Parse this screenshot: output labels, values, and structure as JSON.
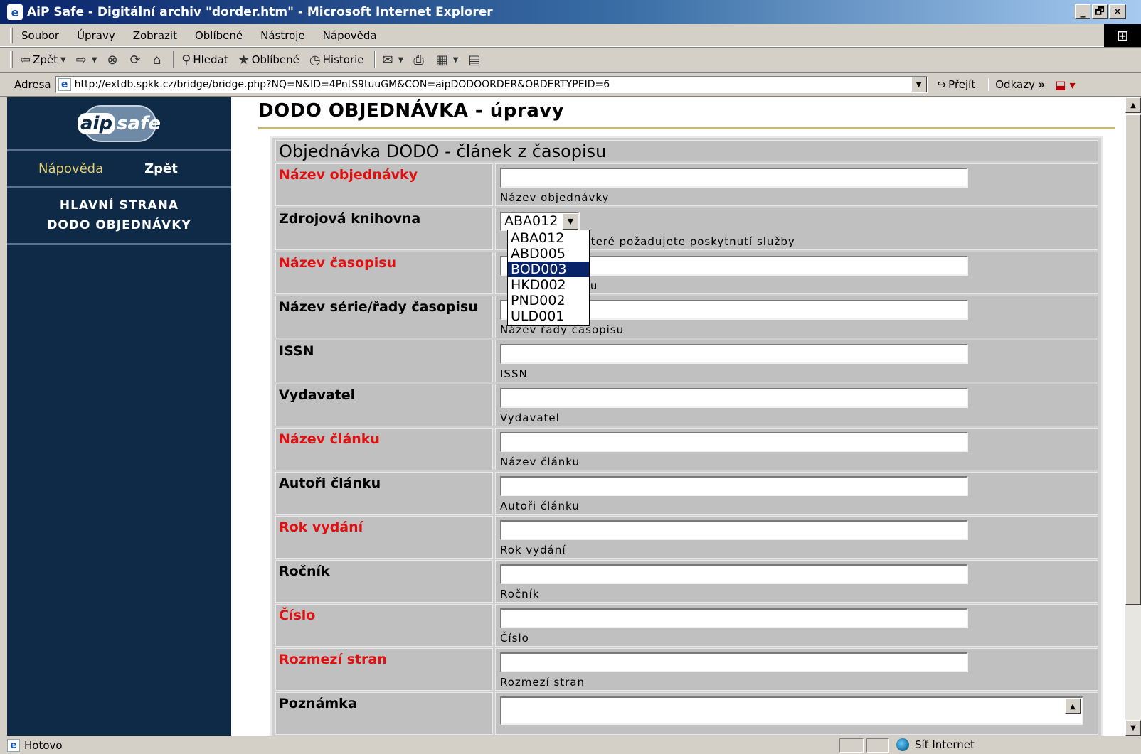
{
  "window": {
    "title": "AiP Safe - Digitální archiv \"dorder.htm\" - Microsoft Internet Explorer",
    "controls": [
      "_",
      "🗗",
      "✕"
    ]
  },
  "menu": [
    "Soubor",
    "Úpravy",
    "Zobrazit",
    "Oblíbené",
    "Nástroje",
    "Nápověda"
  ],
  "toolbar": {
    "back": "Zpět",
    "search": "Hledat",
    "favorites": "Oblíbené",
    "history": "Historie"
  },
  "address": {
    "label": "Adresa",
    "url": "http://extdb.spkk.cz/bridge/bridge.php?NQ=N&ID=4PntS9tuuGM&CON=aipDODOORDER&ORDERTYPEID=6",
    "go": "Přejít",
    "links": "Odkazy"
  },
  "sidebar": {
    "logo": "aipsafe",
    "help": "Nápověda",
    "back": "Zpět",
    "title_line1": "HLAVNÍ STRANA",
    "title_line2": "DODO OBJEDNÁVKY"
  },
  "page": {
    "title": "DODO OBJEDNÁVKA - úpravy",
    "form_title": "Objednávka DODO - článek z časopisu"
  },
  "form": {
    "rows": [
      {
        "label": "Název objednávky",
        "hint": "Název objednávky",
        "required": true
      },
      {
        "label": "Zdrojová knihovna",
        "hint": "které požadujete poskytnutí služby",
        "required": false,
        "type": "select",
        "value": "ABA012"
      },
      {
        "label": "Název časopisu",
        "hint": "su",
        "required": true
      },
      {
        "label": "Název série/řady časopisu",
        "hint": "Název řady časopisu",
        "required": false
      },
      {
        "label": "ISSN",
        "hint": "ISSN",
        "required": false
      },
      {
        "label": "Vydavatel",
        "hint": "Vydavatel",
        "required": false
      },
      {
        "label": "Název článku",
        "hint": "Název článku",
        "required": true
      },
      {
        "label": "Autoři článku",
        "hint": "Autoři článku",
        "required": false
      },
      {
        "label": "Rok vydání",
        "hint": "Rok vydání",
        "required": true
      },
      {
        "label": "Ročník",
        "hint": "Ročník",
        "required": false
      },
      {
        "label": "Číslo",
        "hint": "Číslo",
        "required": true
      },
      {
        "label": "Rozmezí stran",
        "hint": "Rozmezí stran",
        "required": true
      },
      {
        "label": "Poznámka",
        "hint": "",
        "required": false,
        "type": "textarea"
      }
    ],
    "dropdown_options": [
      "ABA012",
      "ABD005",
      "BOD003",
      "HKD002",
      "PND002",
      "ULD001"
    ],
    "dropdown_highlighted": "BOD003"
  },
  "status": {
    "text": "Hotovo",
    "zone": "Síť Internet"
  },
  "colors": {
    "sidebar_bg": "#0e2a47",
    "required_label": "#e01010",
    "help_link": "#e6cf6b",
    "title_rule": "#c8b870"
  }
}
